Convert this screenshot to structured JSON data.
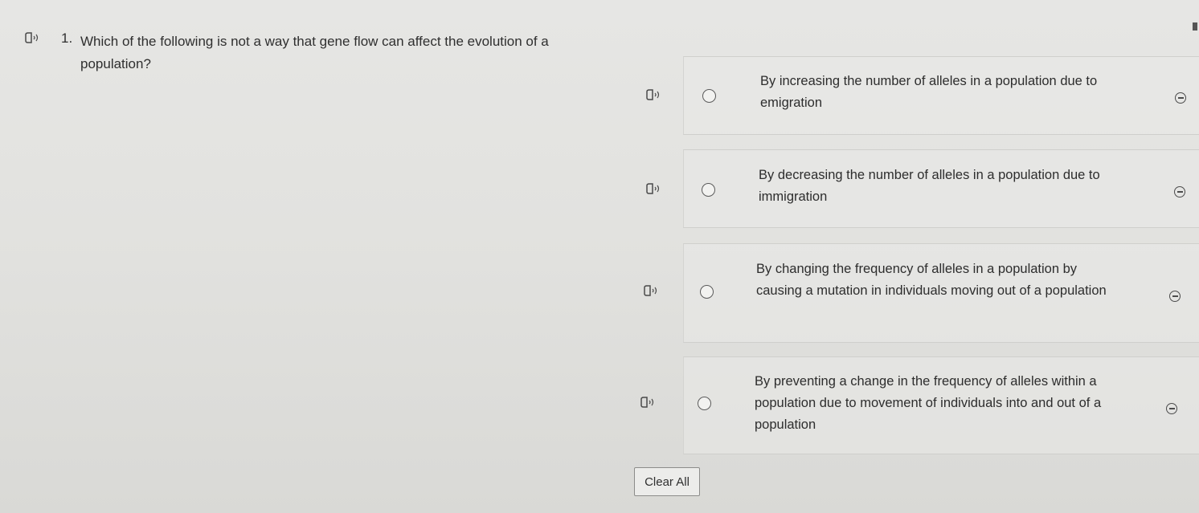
{
  "question": {
    "number": "1.",
    "text": "Which of the following is not a way that gene flow can affect the evolution of a population?"
  },
  "choices": [
    {
      "text": "By increasing the number of alleles in a population due to emigration"
    },
    {
      "text": "By decreasing the number of alleles in a population due to immigration"
    },
    {
      "text": "By changing the frequency of alleles in a population by causing a mutation in individuals moving out of a population"
    },
    {
      "text": "By preventing a change in the frequency of alleles within a population due to movement of individuals into and out of a population"
    }
  ],
  "clear_all_label": "Clear All",
  "icons": {
    "read_aloud": "speaker-icon",
    "select": "radio-button",
    "eliminate": "strikethrough-icon"
  }
}
